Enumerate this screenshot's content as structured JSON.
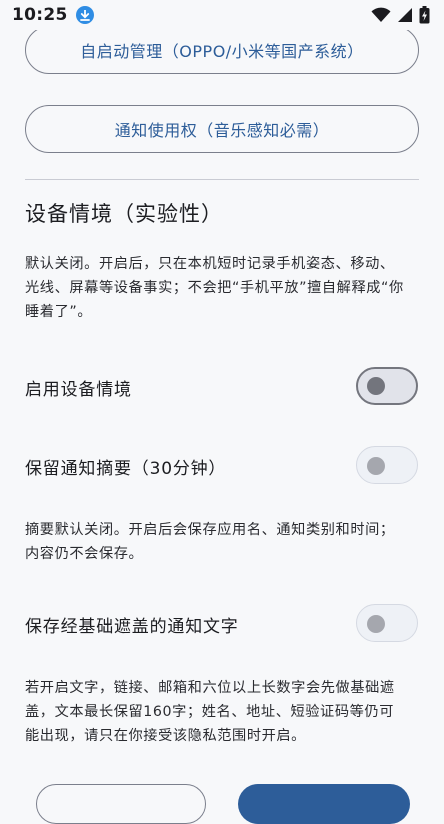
{
  "status_bar": {
    "time": "10:25",
    "icons": [
      "download-icon",
      "wifi-icon",
      "signal-icon",
      "battery-charging-icon"
    ]
  },
  "buttons": {
    "autostart": "自启动管理（OPPO/小米等国产系统）",
    "notification_access": "通知使用权（音乐感知必需）"
  },
  "device_context": {
    "title": "设备情境（实验性）",
    "description_line1": "默认关闭。开启后，只在本机短时记录手机姿态、移动、",
    "description_line2": "光线、屏幕等设备事实；不会把“手机平放”擅自解释成“你",
    "description_line3": "睡着了”。"
  },
  "settings": {
    "enable_device_context": {
      "label": "启用设备情境",
      "enabled": false
    },
    "keep_notification_summary": {
      "label": "保留通知摘要（30分钟）",
      "enabled": false
    },
    "summary_note_line1": "摘要默认关闭。开启后会保存应用名、通知类别和时间；",
    "summary_note_line2": "内容仍不会保存。",
    "keep_masked_text": {
      "label": "保存经基础遮盖的通知文字",
      "enabled": false
    },
    "masked_note_line1": "若开启文字，链接、邮箱和六位以上长数字会先做基础遮",
    "masked_note_line2": "盖，文本最长保留160字；姓名、地址、短验证码等仍可",
    "masked_note_line3": "能出现，请只在你接受该隐私范围时开启。"
  },
  "colors": {
    "accent": "#2d5d99",
    "background": "#f7f8fa",
    "outline": "#7b7f8c"
  }
}
